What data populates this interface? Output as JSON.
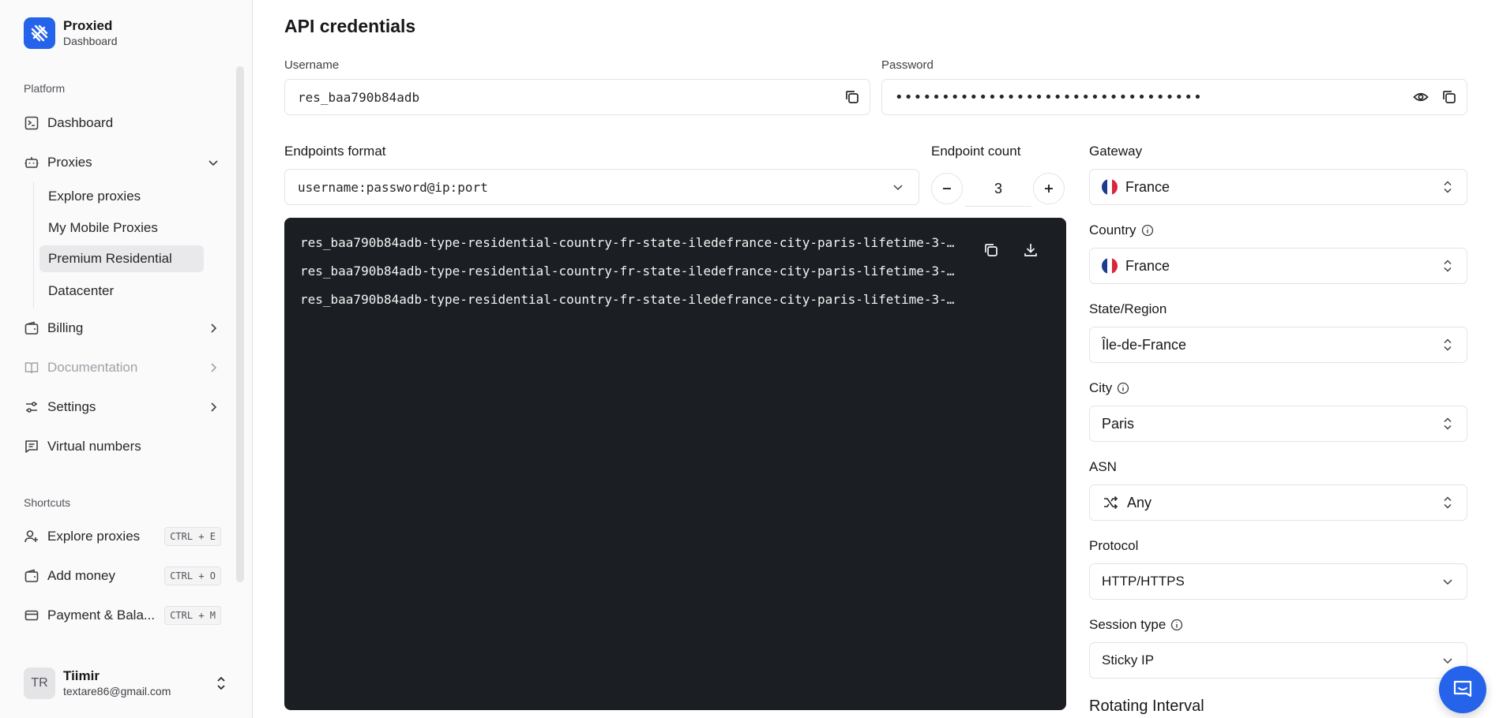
{
  "brand": {
    "name": "Proxied",
    "subtitle": "Dashboard"
  },
  "sidebar": {
    "platform_label": "Platform",
    "items": [
      {
        "label": "Dashboard",
        "icon": "dashboard-icon"
      },
      {
        "label": "Proxies",
        "icon": "bot-icon",
        "expanded": true
      },
      {
        "label": "Billing",
        "icon": "wallet-icon"
      },
      {
        "label": "Documentation",
        "icon": "book-icon",
        "disabled": true
      },
      {
        "label": "Settings",
        "icon": "sliders-icon"
      },
      {
        "label": "Virtual numbers",
        "icon": "message-square-icon"
      }
    ],
    "proxies_sub": [
      "Explore proxies",
      "My Mobile Proxies",
      "Premium Residential",
      "Datacenter"
    ],
    "active_sub": "Premium Residential",
    "shortcuts_label": "Shortcuts",
    "shortcuts": [
      {
        "label": "Explore proxies",
        "key": "CTRL + E",
        "icon": "user-plus-icon"
      },
      {
        "label": "Add money",
        "key": "CTRL + O",
        "icon": "wallet-icon"
      },
      {
        "label": "Payment & Bala...",
        "key": "CTRL + M",
        "icon": "credit-card-icon"
      }
    ]
  },
  "user": {
    "initials": "TR",
    "name": "Tiimir",
    "email": "textare86@gmail.com"
  },
  "main": {
    "title": "API credentials",
    "username_label": "Username",
    "username_value": "res_baa790b84adb",
    "password_label": "Password",
    "password_masked": "•••••••••••••••••••••••••••••••••",
    "endpoints_format_label": "Endpoints format",
    "endpoints_format_value": "username:password@ip:port",
    "endpoint_count_label": "Endpoint count",
    "endpoint_count": "3",
    "endpoints": [
      "res_baa790b84adb-type-residential-country-fr-state-iledefrance-city-paris-lifetime-3-…",
      "res_baa790b84adb-type-residential-country-fr-state-iledefrance-city-paris-lifetime-3-…",
      "res_baa790b84adb-type-residential-country-fr-state-iledefrance-city-paris-lifetime-3-…"
    ]
  },
  "settings": {
    "gateway_label": "Gateway",
    "gateway_value": "France",
    "country_label": "Country",
    "country_value": "France",
    "state_label": "State/Region",
    "state_value": "Île-de-France",
    "city_label": "City",
    "city_value": "Paris",
    "asn_label": "ASN",
    "asn_value": "Any",
    "protocol_label": "Protocol",
    "protocol_value": "HTTP/HTTPS",
    "session_label": "Session type",
    "session_value": "Sticky IP",
    "rotating_label": "Rotating Interval"
  },
  "colors": {
    "accent": "#2563eb",
    "code_bg": "#1b1e22",
    "active_bg": "#e9e9eb"
  }
}
